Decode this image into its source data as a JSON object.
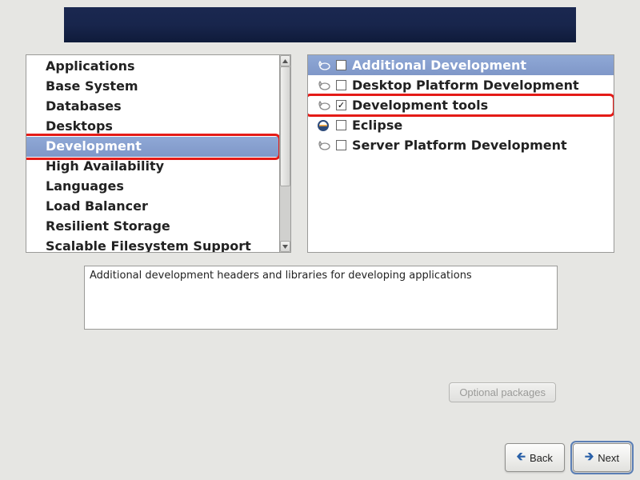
{
  "banner": {},
  "categories": {
    "items": [
      {
        "label": "Applications"
      },
      {
        "label": "Base System"
      },
      {
        "label": "Databases"
      },
      {
        "label": "Desktops"
      },
      {
        "label": "Development",
        "selected": true,
        "highlighted": true
      },
      {
        "label": "High Availability"
      },
      {
        "label": "Languages"
      },
      {
        "label": "Load Balancer"
      },
      {
        "label": "Resilient Storage"
      },
      {
        "label": "Scalable Filesystem Support"
      }
    ]
  },
  "packages": {
    "items": [
      {
        "label": "Additional Development",
        "icon": "package",
        "checked": false,
        "selected": true
      },
      {
        "label": "Desktop Platform Development",
        "icon": "package",
        "checked": false
      },
      {
        "label": "Development tools",
        "icon": "package",
        "checked": true,
        "highlighted": true
      },
      {
        "label": "Eclipse",
        "icon": "eclipse",
        "checked": false
      },
      {
        "label": "Server Platform Development",
        "icon": "package",
        "checked": false
      }
    ]
  },
  "description": "Additional development headers and libraries for developing applications",
  "buttons": {
    "optional": "Optional packages",
    "back": "Back",
    "next": "Next"
  }
}
